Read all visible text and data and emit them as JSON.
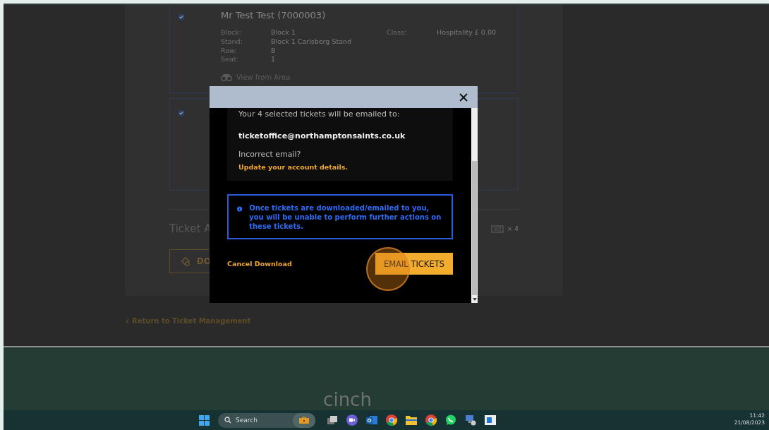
{
  "background_page": {
    "tickets": [
      {
        "checked": true,
        "name": "Mr Test Test (7000003)",
        "details": [
          {
            "label": "Block:",
            "value": "Block 1"
          },
          {
            "label": "Stand:",
            "value": "Block 1 Carlsberg Stand"
          },
          {
            "label": "Row:",
            "value": "B"
          },
          {
            "label": "Seat:",
            "value": "1"
          }
        ],
        "class_label": "Class:",
        "class_value": "Hospitality £ 0.00",
        "view_link": "View from Area"
      },
      {
        "checked": true
      }
    ],
    "section_title": "Ticket A",
    "ticket_count": "× 4",
    "download_button": "DO",
    "return_link": "Return to Ticket Management"
  },
  "modal": {
    "message": "Your 4 selected tickets will be emailed to:",
    "email": "ticketoffice@northamptonsaints.co.uk",
    "incorrect": "Incorrect email?",
    "update_link": "Update your account details.",
    "info": "Once tickets are downloaded/emailed to you, you will be unable to perform further actions on these tickets.",
    "cancel": "Cancel Download",
    "confirm": "EMAIL TICKETS"
  },
  "footer_logo": "cinch",
  "taskbar": {
    "search_placeholder": "Search",
    "time": "11:42",
    "date": "21/08/2023"
  }
}
